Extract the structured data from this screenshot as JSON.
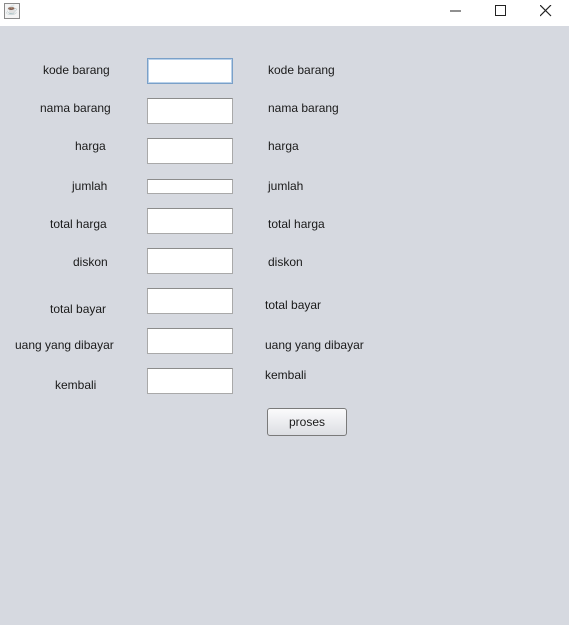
{
  "titlebar": {
    "icon": "java-cup-icon",
    "controls": [
      "minimize-icon",
      "maximize-icon",
      "close-icon"
    ]
  },
  "form": {
    "left_labels": {
      "kode_barang": "kode barang",
      "nama_barang": "nama barang",
      "harga": "harga",
      "jumlah": "jumlah",
      "total_harga": "total harga",
      "diskon": "diskon",
      "total_bayar": "total bayar",
      "uang_dibayar": "uang yang dibayar",
      "kembali": "kembali"
    },
    "fields": {
      "kode_barang": "",
      "nama_barang": "",
      "harga": "",
      "jumlah": "",
      "total_harga": "",
      "diskon": "",
      "total_bayar": "",
      "uang_dibayar": "",
      "kembali": ""
    },
    "right_labels": {
      "kode_barang": "kode barang",
      "nama_barang": "nama barang",
      "harga": "harga",
      "jumlah": "jumlah",
      "total_harga": "total harga",
      "diskon": "diskon",
      "total_bayar": "total bayar",
      "uang_dibayar": "uang yang dibayar",
      "kembali": "kembali"
    },
    "submit_label": "proses"
  }
}
